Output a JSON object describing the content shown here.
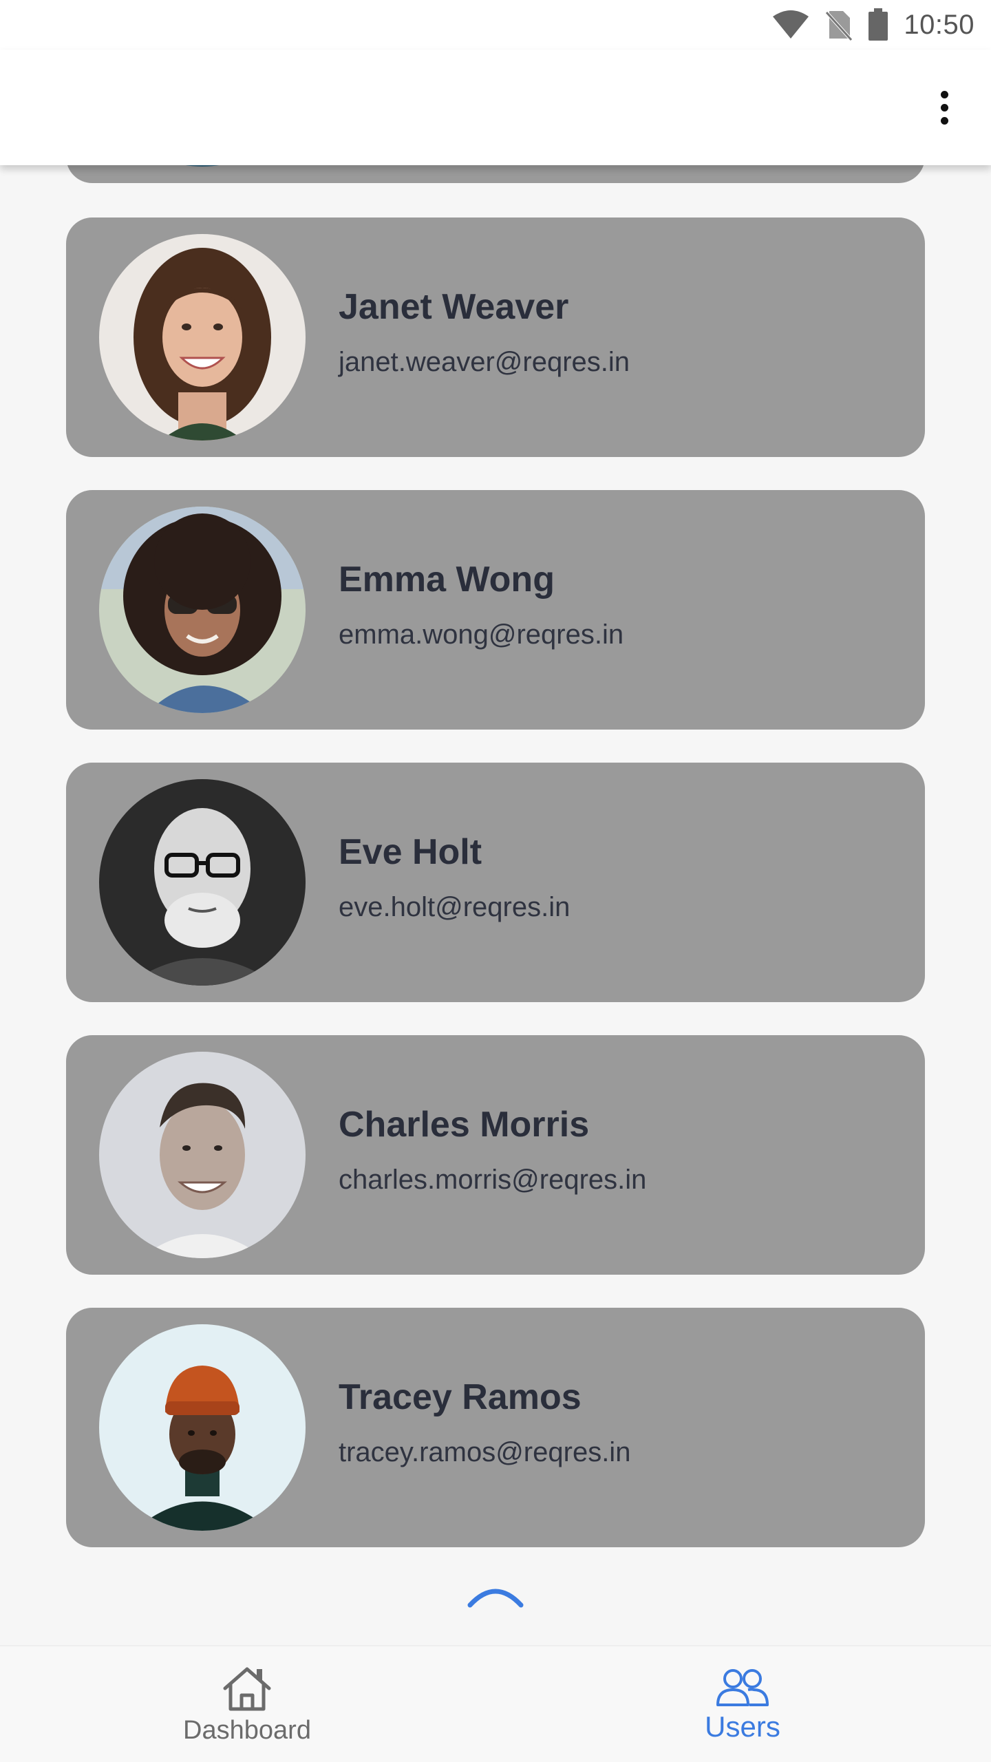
{
  "status_bar": {
    "time": "10:50",
    "icons": [
      "wifi-icon",
      "no-sim-icon",
      "battery-icon"
    ]
  },
  "app_bar": {
    "menu_icon": "more-vert-icon"
  },
  "users": [
    {
      "name": "Janet Weaver",
      "email": "janet.weaver@reqres.in"
    },
    {
      "name": "Emma Wong",
      "email": "emma.wong@reqres.in"
    },
    {
      "name": "Eve Holt",
      "email": "eve.holt@reqres.in"
    },
    {
      "name": "Charles Morris",
      "email": "charles.morris@reqres.in"
    },
    {
      "name": "Tracey Ramos",
      "email": "tracey.ramos@reqres.in"
    }
  ],
  "bottom_nav": {
    "items": [
      {
        "label": "Dashboard",
        "icon": "home-icon",
        "active": false
      },
      {
        "label": "Users",
        "icon": "users-icon",
        "active": true
      }
    ]
  },
  "colors": {
    "card_bg": "#9a9a9a",
    "accent": "#3b7be0",
    "page_bg": "#f6f6f6"
  }
}
